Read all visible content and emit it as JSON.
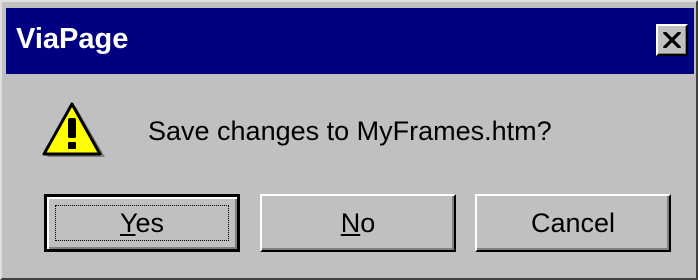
{
  "window": {
    "title": "ViaPage",
    "close_icon": "close-x-icon"
  },
  "message": {
    "icon": "warning-exclamation-icon",
    "text": "Save changes to MyFrames.htm?"
  },
  "buttons": {
    "yes": {
      "mnemonic": "Y",
      "rest": "es",
      "is_default": true
    },
    "no": {
      "mnemonic": "N",
      "rest": "o"
    },
    "cancel": {
      "label": "Cancel"
    }
  },
  "colors": {
    "titlebar": "#000080",
    "face": "#c0c0c0",
    "warning_yellow": "#ffff00"
  }
}
